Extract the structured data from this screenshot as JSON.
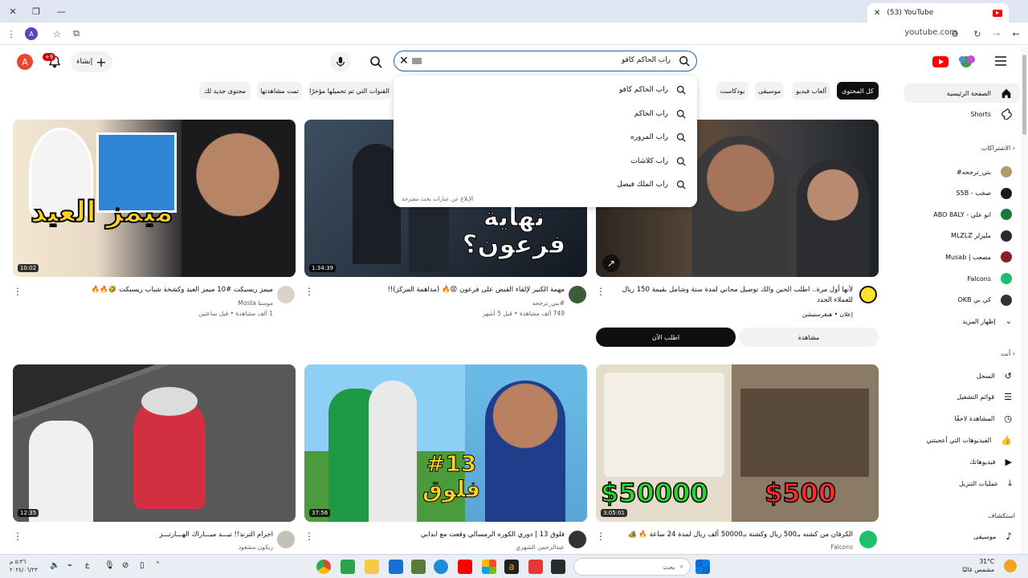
{
  "browser": {
    "tab_title": "(53) YouTube",
    "url": "youtube.com",
    "profile_initial": "A"
  },
  "header": {
    "avatar_initial": "A",
    "notif_badge": "+9",
    "create_label": "إنشاء",
    "search_value": "راب الحاكم كافو"
  },
  "chips": [
    "كل المحتوى",
    "ألعاب فيديو",
    "موسيقى",
    "بودكاست",
    "القنوات التي تم تحميلها مؤخرًا",
    "تمت مشاهدتها",
    "محتوى جديد لك"
  ],
  "dropdown": {
    "suggestions": [
      "راب الحاكم كافو",
      "راب الحاكم",
      "راب المروره",
      "راب كلاشات",
      "راب الملك فيصل"
    ],
    "report": "الإبلاغ عن عبارات بحث مقترحة"
  },
  "videos": [
    {
      "title": "ميمز ريسبكت #10 ميمز العيد وكشخة شباب ريسبكت 🤣🔥🔥",
      "channel": "موستا Mosta",
      "meta": "1 ألف مشاهدة • قبل ساعتين",
      "duration": "10:02",
      "thumb_text": "ميمز العيد"
    },
    {
      "title": "مهمة الكبير لإلقاء القبض على فرعون 😡🔥 (مداهمة المركز)!!",
      "channel": "#بني_ترجحه",
      "meta": "749 ألف مشاهدة • قبل 5 أشهر",
      "duration": "1:34:39",
      "thumb_text": "نهاية فرعون؟"
    },
    {
      "title": "لأنها أول مرة.. اطلب الحين والك توصيل مجاني لمدة سنة وشامل بقيمة 150 ريال للعملاء الجدد",
      "channel": "هنقرستيشن",
      "meta": "إعلان",
      "duration": "",
      "thumb_text": ""
    },
    {
      "title": "اجرام الترند!! تيـــد ميـــاراك الهـــارتـــز",
      "channel": "زيكون مشعوذ",
      "meta": "",
      "duration": "12:35",
      "thumb_text": ""
    },
    {
      "title": "فلوق 13 | دوري الكوره الرمسالي وقعت مع ابدابي",
      "channel": "عبدالرحمن الشهري",
      "meta": "",
      "duration": "37:56",
      "thumb_text": "#13 فلوق"
    },
    {
      "title": "الكرفان من كشته بـ500 ريال وكشتة بـ50000 ألف ريال لمدة 24 ساعة 🔥 🏕️",
      "channel": "Falcons",
      "meta": "",
      "duration": "3:05:01",
      "thumb_text_a": "$50000",
      "thumb_text_b": "$500"
    }
  ],
  "ad": {
    "cta_primary": "اطلب الآن",
    "cta_secondary": "مشاهدة"
  },
  "sidebar": {
    "home": "الصفحة الرئيسية",
    "shorts": "Shorts",
    "subs_header": "الاشتراكات",
    "subs": [
      "#بني_ترجحه",
      "S5B - صخب",
      "ABO 8ALY - ابو علي",
      "MLZLZ مليزلز",
      "Musab | مصعب",
      "Falcons",
      "OKB كي بي"
    ],
    "show_more": "إظهار المزيد",
    "you_header": "أنت",
    "you": [
      "السجل",
      "قوائم التشغيل",
      "المشاهدة لاحقًا",
      "الفيديوهات التي أعجبتني",
      "فيديوهاتك",
      "عمليات التنزيل"
    ],
    "explore_header": "استكشاف",
    "music": "موسيقى"
  },
  "taskbar": {
    "search_label": "بحث",
    "temp": "31°C",
    "weather": "مشمس غالبًا",
    "time": "٥:٣٦ م",
    "date": "٢٠٢٤/٠٦/٢٣"
  }
}
